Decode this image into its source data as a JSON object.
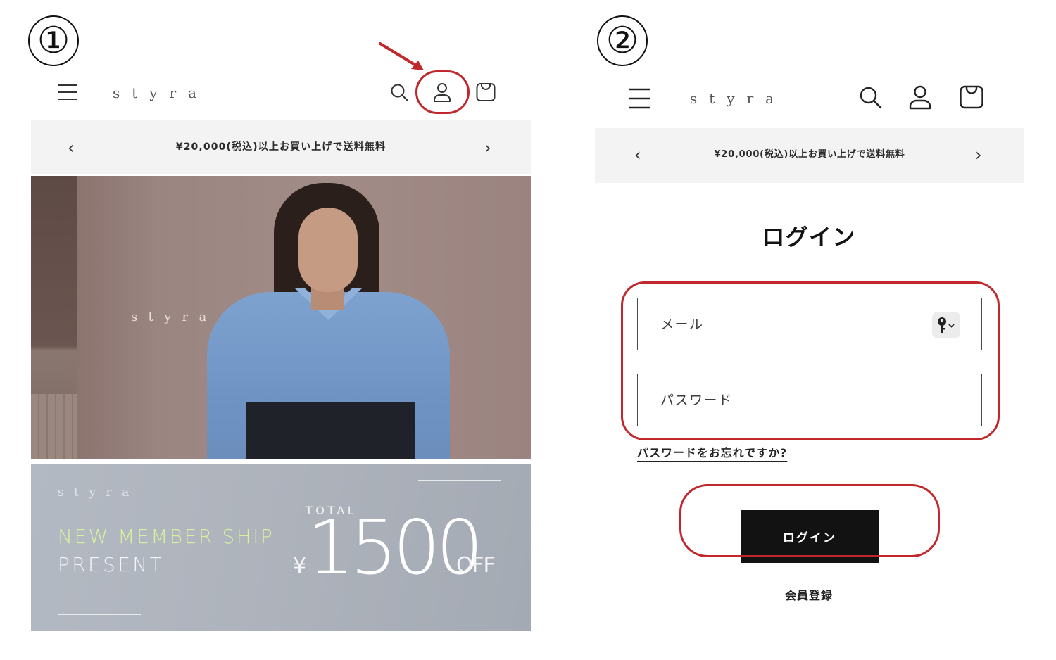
{
  "steps": {
    "step1": "①",
    "step2": "②"
  },
  "colors": {
    "annotation_red": "#c0282d",
    "button_black": "#121212",
    "banner_gray": "#f3f3f3",
    "promo_accent": "#d9f0a0"
  },
  "panel1": {
    "header": {
      "menu_icon": "hamburger-menu-icon",
      "logo": "styra",
      "search_icon": "search-icon",
      "account_icon": "account-user-icon",
      "cart_icon": "shopping-bag-icon"
    },
    "announcement": {
      "text": "¥20,000(税込)以上お買い上げで送料無料",
      "prev_icon": "chevron-left-icon",
      "next_icon": "chevron-right-icon",
      "prev": "‹",
      "next": "›"
    },
    "hero": {
      "logo": "styra"
    },
    "promo": {
      "logo": "styra",
      "line1": "NEW MEMBER SHIP",
      "line2": "PRESENT",
      "total_label": "TOTAL",
      "currency": "¥",
      "amount": "1500",
      "suffix": "OFF"
    }
  },
  "panel2": {
    "header": {
      "menu_icon": "hamburger-menu-icon",
      "logo": "styra",
      "search_icon": "search-icon",
      "account_icon": "account-user-icon",
      "cart_icon": "shopping-bag-icon"
    },
    "announcement": {
      "text": "¥20,000(税込)以上お買い上げで送料無料",
      "prev": "‹",
      "next": "›"
    },
    "login": {
      "title": "ログイン",
      "email_placeholder": "メール",
      "password_placeholder": "パスワード",
      "key_icon": "password-key-icon",
      "forgot_link": "パスワードをお忘れですか?",
      "submit_label": "ログイン",
      "register_link": "会員登録"
    }
  }
}
